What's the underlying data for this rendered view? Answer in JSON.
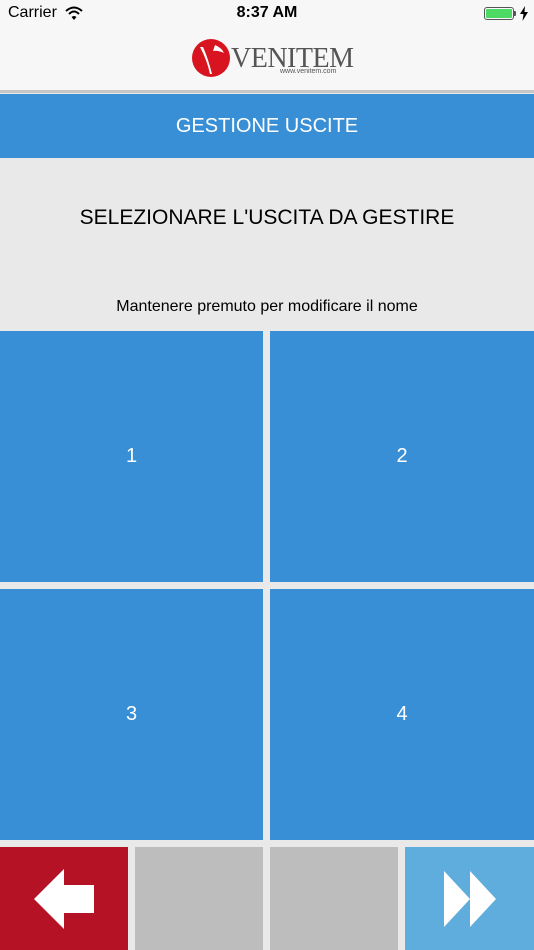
{
  "status_bar": {
    "carrier": "Carrier",
    "time": "8:37 AM",
    "battery_level": 1.0
  },
  "header": {
    "logo_word": "VENITEM",
    "logo_url": "www.venitem.com"
  },
  "title_bar": {
    "title": "GESTIONE USCITE"
  },
  "content": {
    "instruction": "SELEZIONARE L'USCITA DA GESTIRE",
    "hint": "Mantenere premuto per modificare il nome"
  },
  "outputs": [
    {
      "label": "1"
    },
    {
      "label": "2"
    },
    {
      "label": "3"
    },
    {
      "label": "4"
    }
  ],
  "bottom_bar": {
    "back_icon": "arrow-left-icon",
    "next_icon": "fast-forward-icon"
  },
  "colors": {
    "primary_blue": "#398fd5",
    "back_red": "#b51325",
    "disabled_gray": "#bdbdbd",
    "next_light_blue": "#5eaddc",
    "background": "#e9e9e9"
  }
}
